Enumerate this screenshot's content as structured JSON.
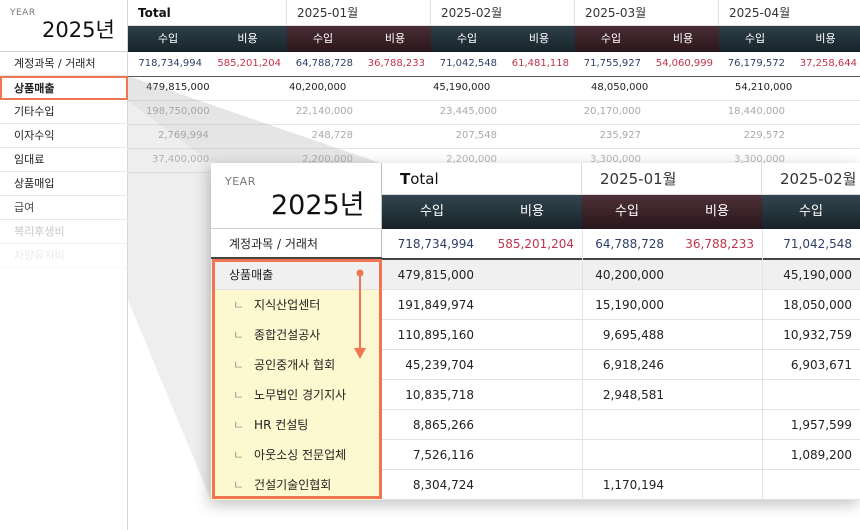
{
  "year": {
    "label": "YEAR",
    "value": "2025년"
  },
  "columns": {
    "total": "Total",
    "months": [
      "2025-01월",
      "2025-02월",
      "2025-03월",
      "2025-04월"
    ],
    "income": "수입",
    "expense": "비용"
  },
  "account_header": "계정과목 / 거래처",
  "background_table": {
    "sum_row": [
      "718,734,994",
      "585,201,204",
      "64,788,728",
      "36,788,233",
      "71,042,548",
      "61,481,118",
      "71,755,927",
      "54,060,999",
      "76,179,572",
      "37,258,644"
    ],
    "rows": [
      {
        "label": "상품매출",
        "values": [
          "479,815,000",
          "",
          "40,200,000",
          "",
          "45,190,000",
          "",
          "48,050,000",
          "",
          "54,210,000",
          ""
        ]
      },
      {
        "label": "기타수입",
        "values": [
          "198,750,000",
          "",
          "22,140,000",
          "",
          "23,445,000",
          "",
          "20,170,000",
          "",
          "18,440,000",
          ""
        ]
      },
      {
        "label": "이자수익",
        "values": [
          "2,769,994",
          "",
          "248,728",
          "",
          "207,548",
          "",
          "235,927",
          "",
          "229,572",
          ""
        ]
      },
      {
        "label": "임대료",
        "values": [
          "37,400,000",
          "",
          "2,200,000",
          "",
          "2,200,000",
          "",
          "3,300,000",
          "",
          "3,300,000",
          ""
        ]
      },
      {
        "label": "상품매입",
        "values": []
      },
      {
        "label": "급여",
        "values": []
      },
      {
        "label": "복리후생비",
        "values": []
      },
      {
        "label": "차량유지비",
        "values": []
      }
    ]
  },
  "zoom_table": {
    "sum_row": [
      "718,734,994",
      "585,201,204",
      "64,788,728",
      "36,788,233",
      "71,042,548"
    ],
    "main_row": {
      "label": "상품매출",
      "values": [
        "479,815,000",
        "40,200,000",
        "45,190,000"
      ]
    },
    "sub_rows": [
      {
        "label": "지식산업센터",
        "total": "191,849,974",
        "m1": "15,190,000",
        "m2": "18,050,000"
      },
      {
        "label": "종합건설공사",
        "total": "110,895,160",
        "m1": "9,695,488",
        "m2": "10,932,759"
      },
      {
        "label": "공인중개사 협회",
        "total": "45,239,704",
        "m1": "6,918,246",
        "m2": "6,903,671"
      },
      {
        "label": "노무법인 경기지사",
        "total": "10,835,718",
        "m1": "2,948,581",
        "m2": ""
      },
      {
        "label": "HR 컨설팅",
        "total": "8,865,266",
        "m1": "",
        "m2": "1,957,599"
      },
      {
        "label": "아웃소싱 전문업체",
        "total": "7,526,116",
        "m1": "",
        "m2": "1,089,200"
      },
      {
        "label": "건설기술인협회",
        "total": "8,304,724",
        "m1": "1,170,194",
        "m2": ""
      }
    ],
    "indent_glyph": "ㄴ"
  },
  "colors": {
    "highlight": "#f07552",
    "expense_red": "#c2334d",
    "income_blue": "#2c3e66",
    "sub_row_bg": "#fdf8cf"
  }
}
